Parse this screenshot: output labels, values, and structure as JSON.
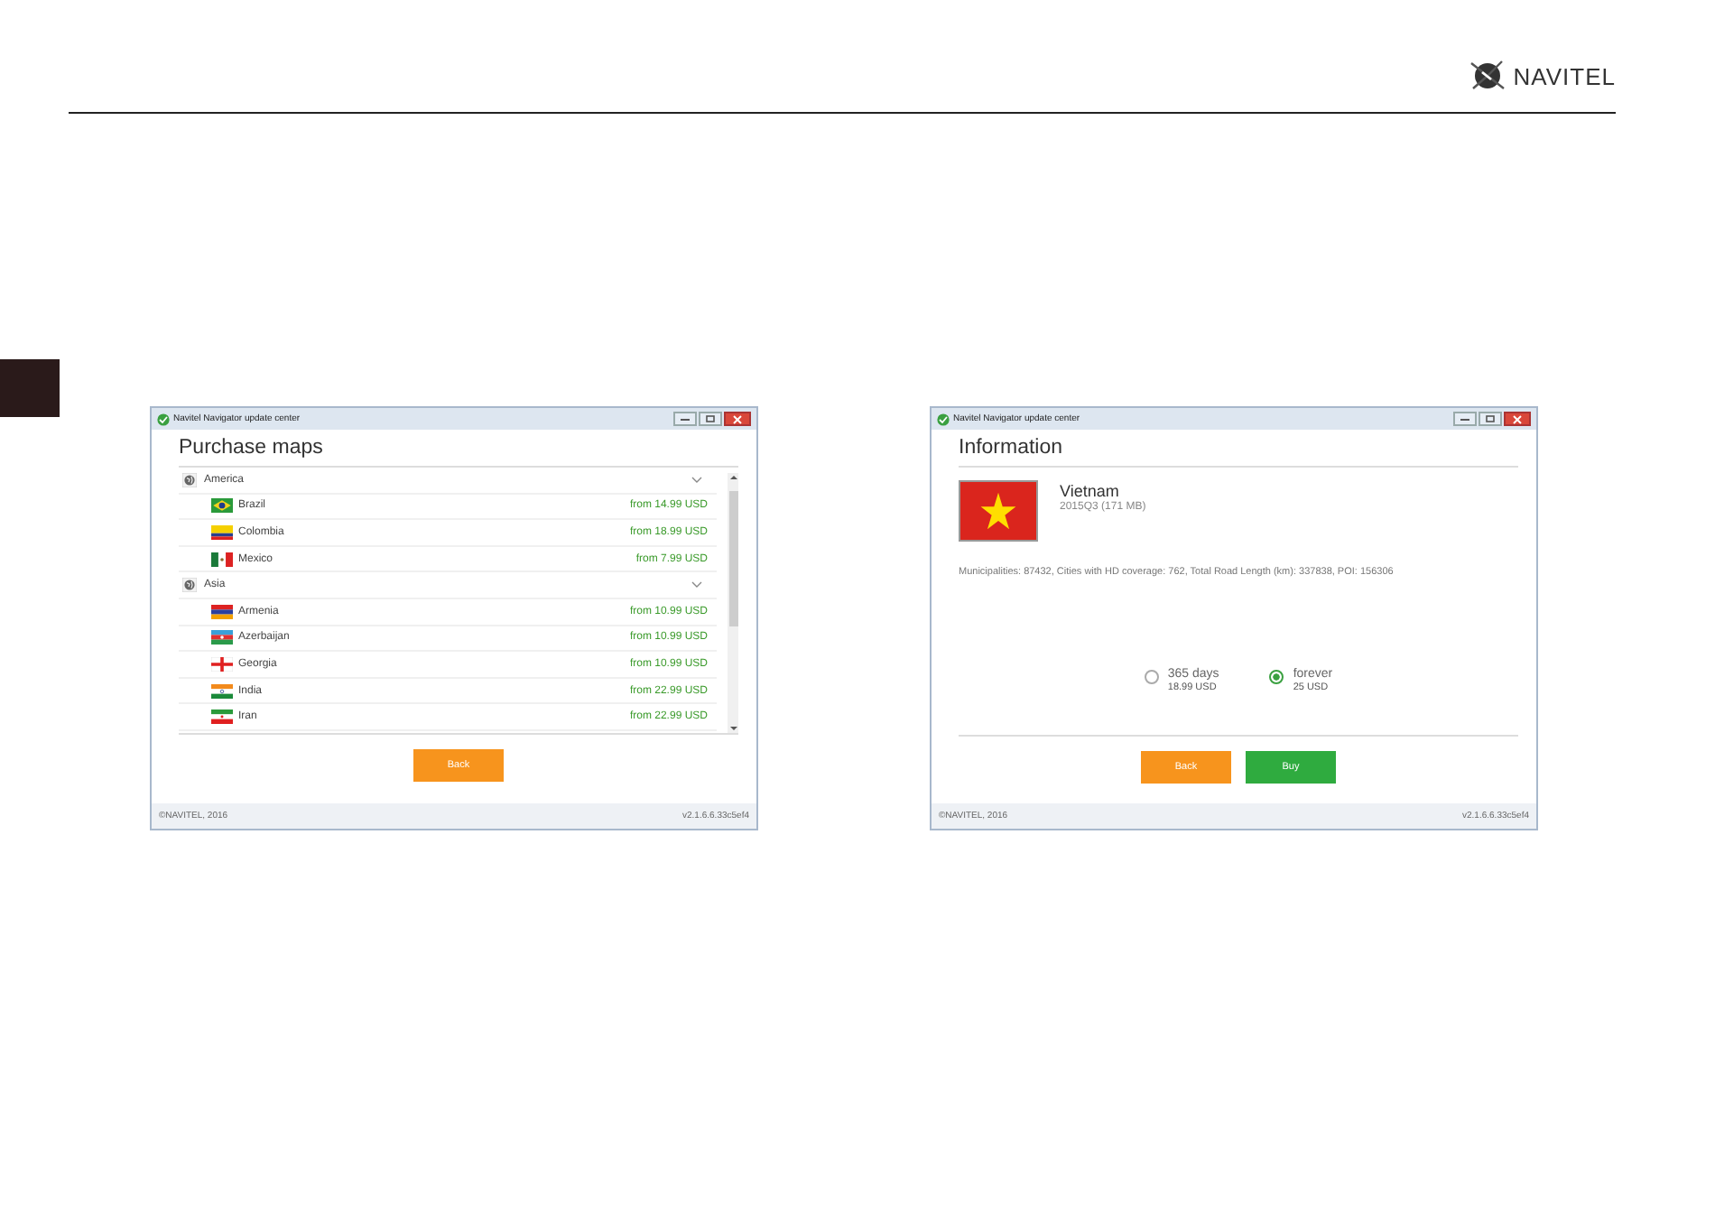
{
  "logo": {
    "text": "NAVITEL"
  },
  "windows": [
    {
      "kind": "purchase",
      "title": "Navitel Navigator update center",
      "heading": "Purchase maps",
      "groups": [
        {
          "name": "America",
          "expanded": true,
          "items": [
            {
              "name": "Brazil",
              "kind": "brazil",
              "price": "from 14.99 USD"
            },
            {
              "name": "Colombia",
              "kind": "colombia",
              "price": "from 18.99 USD"
            },
            {
              "name": "Mexico",
              "kind": "mexico",
              "price": "from 7.99 USD"
            }
          ]
        },
        {
          "name": "Asia",
          "expanded": true,
          "items": [
            {
              "name": "Armenia",
              "kind": "armenia",
              "price": "from 10.99 USD"
            },
            {
              "name": "Azerbaijan",
              "kind": "azerbaijan",
              "price": "from 10.99 USD"
            },
            {
              "name": "Georgia",
              "kind": "georgia",
              "price": "from 10.99 USD"
            },
            {
              "name": "India",
              "kind": "india",
              "price": "from 22.99 USD"
            },
            {
              "name": "Iran",
              "kind": "iran",
              "price": "from 22.99 USD"
            }
          ]
        }
      ],
      "buttons": [
        {
          "label": "Back",
          "kind": "back"
        }
      ],
      "footer_left": "©NAVITEL, 2016",
      "footer_right": "v2.1.6.6.33c5ef4"
    },
    {
      "kind": "info",
      "title": "Navitel Navigator update center",
      "heading": "Information",
      "country": {
        "name": "Vietnam",
        "version": "2015Q3 (171 MB)",
        "kind": "vietnam"
      },
      "details": "Municipalities: 87432, Cities with HD coverage: 762, Total Road Length (km): 337838, POI: 156306",
      "options": [
        {
          "label": "365 days",
          "price": "18.99 USD",
          "selected": false
        },
        {
          "label": "forever",
          "price": "25 USD",
          "selected": true
        }
      ],
      "buttons": [
        {
          "label": "Back",
          "kind": "back"
        },
        {
          "label": "Buy",
          "kind": "buy"
        }
      ],
      "footer_left": "©NAVITEL, 2016",
      "footer_right": "v2.1.6.6.33c5ef4"
    }
  ]
}
